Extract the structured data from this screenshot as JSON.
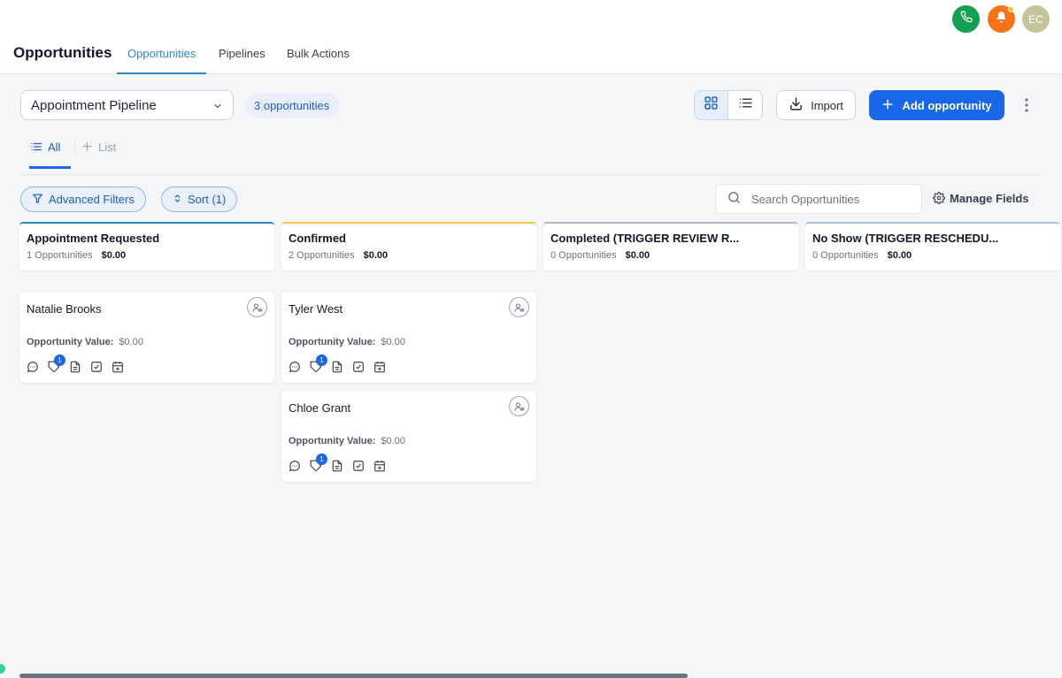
{
  "header": {
    "title": "Opportunities",
    "tabs": [
      {
        "label": "Opportunities",
        "active": true
      },
      {
        "label": "Pipelines",
        "active": false
      },
      {
        "label": "Bulk Actions",
        "active": false
      }
    ],
    "avatar_initials": "EC",
    "icons": {
      "phone": "phone-icon",
      "bell": "bell-icon"
    }
  },
  "toolbar": {
    "pipeline": "Appointment Pipeline",
    "count_label": "3 opportunities",
    "import_label": "Import",
    "add_label": "Add opportunity"
  },
  "subtabs": {
    "all": "All",
    "list": "List"
  },
  "filters": {
    "advanced": "Advanced Filters",
    "sort": "Sort (1)",
    "search_placeholder": "Search Opportunities",
    "manage_fields": "Manage Fields"
  },
  "columns": [
    {
      "title": "Appointment Requested",
      "count": "1 Opportunities",
      "total": "$0.00",
      "color": "#2b8ac6"
    },
    {
      "title": "Confirmed",
      "count": "2 Opportunities",
      "total": "$0.00",
      "color": "#f2c94c"
    },
    {
      "title": "Completed (TRIGGER REVIEW R...",
      "count": "0 Opportunities",
      "total": "$0.00",
      "color": "#b0b7c3"
    },
    {
      "title": "No Show (TRIGGER RESCHEDU...",
      "count": "0 Opportunities",
      "total": "$0.00",
      "color": "#a9c1e8"
    }
  ],
  "cards": [
    {
      "name": "Natalie Brooks",
      "value_label": "Opportunity Value:",
      "value": "$0.00",
      "badge": "1"
    },
    {
      "name": "Tyler West",
      "value_label": "Opportunity Value:",
      "value": "$0.00",
      "badge": "1"
    },
    {
      "name": "Chloe Grant",
      "value_label": "Opportunity Value:",
      "value": "$0.00",
      "badge": "1"
    }
  ],
  "colors": {
    "accent": "#1a66e8",
    "tab_active": "#2b8ac6",
    "pill_bg": "#e9f0fb"
  }
}
